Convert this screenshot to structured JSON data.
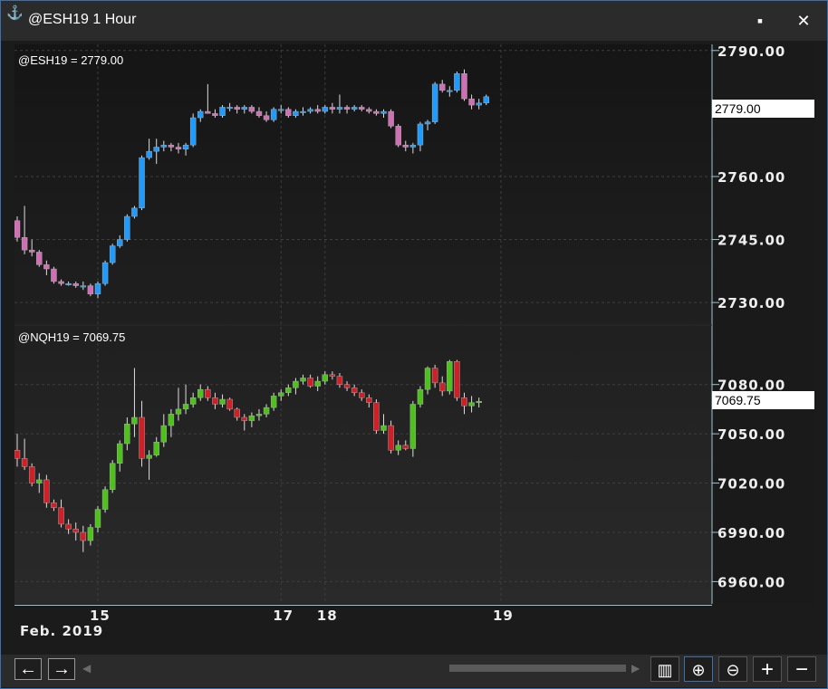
{
  "window": {
    "title": "@ESH19 1 Hour",
    "app_icon": "bull-bear-icon",
    "maximize_icon": "maximize-icon",
    "close_icon": "close-icon",
    "maximize_glyph": "▪",
    "close_glyph": "✕"
  },
  "colors": {
    "es_bull": "#1e9bff",
    "es_bear": "#d070b4",
    "nq_bull": "#4cc21a",
    "nq_bear": "#cf2028",
    "wick": "#dddddd",
    "grid": "#3e3e3e",
    "axis": "#9fc6d6"
  },
  "xaxis": {
    "ticks": [
      {
        "label": "15",
        "index": 11
      },
      {
        "label": "17",
        "index": 36
      },
      {
        "label": "18",
        "index": 42
      },
      {
        "label": "19",
        "index": 66
      }
    ],
    "sublabel": "Feb. 2019"
  },
  "toolbar": {
    "back_glyph": "←",
    "forward_glyph": "→",
    "scroll_left_glyph": "◀",
    "scroll_right_glyph": "▶",
    "columns_glyph": "▥",
    "zoom_in_glyph": "⊕",
    "zoom_out_glyph": "⊖",
    "plus_glyph": "+",
    "minus_glyph": "−"
  },
  "chart_data": [
    {
      "type": "candlestick",
      "label": "@ESH19 = 2779.00",
      "last_value": "2779.00",
      "yticks": [
        "2790.00",
        "2760.00",
        "2745.00",
        "2730.00"
      ],
      "ytick_values": [
        2790,
        2760,
        2745,
        2730
      ],
      "ylim": [
        2725.5,
        2790.6
      ],
      "ohlc": [
        [
          2749.5,
          2750.5,
          2744.5,
          2745.5
        ],
        [
          2745.5,
          2753,
          2741.5,
          2742.5
        ],
        [
          2742.5,
          2745,
          2741,
          2742
        ],
        [
          2742,
          2742.5,
          2738.5,
          2739
        ],
        [
          2739,
          2740,
          2736.5,
          2738
        ],
        [
          2738,
          2738.5,
          2734.5,
          2735
        ],
        [
          2735,
          2735.5,
          2734,
          2734.5
        ],
        [
          2734.5,
          2735,
          2734,
          2734.5
        ],
        [
          2734.5,
          2735,
          2733.5,
          2734
        ],
        [
          2734,
          2735,
          2733,
          2734
        ],
        [
          2734,
          2734.5,
          2731.5,
          2732
        ],
        [
          2732,
          2735,
          2731,
          2734.5
        ],
        [
          2734.5,
          2740,
          2734,
          2739.5
        ],
        [
          2739.5,
          2744,
          2739,
          2743.5
        ],
        [
          2743.5,
          2746,
          2743,
          2745
        ],
        [
          2745,
          2751,
          2744.5,
          2750.5
        ],
        [
          2750.5,
          2753,
          2750,
          2752.5
        ],
        [
          2752.5,
          2765,
          2752,
          2764.5
        ],
        [
          2764.5,
          2769,
          2764,
          2766
        ],
        [
          2766,
          2769,
          2763,
          2767
        ],
        [
          2767,
          2768.5,
          2766,
          2767.5
        ],
        [
          2767.5,
          2768,
          2766,
          2767
        ],
        [
          2767,
          2768,
          2765.5,
          2766.5
        ],
        [
          2766.5,
          2768,
          2765,
          2767.5
        ],
        [
          2767.5,
          2775,
          2767,
          2774
        ],
        [
          2774,
          2776,
          2773,
          2775.5
        ],
        [
          2775.5,
          2782,
          2775,
          2775
        ],
        [
          2775,
          2776,
          2774,
          2774.5
        ],
        [
          2774.5,
          2777,
          2774,
          2776.5
        ],
        [
          2776.5,
          2777.5,
          2775.5,
          2776.5
        ],
        [
          2776.5,
          2777,
          2775,
          2776
        ],
        [
          2776,
          2777,
          2775,
          2776.5
        ],
        [
          2776.5,
          2777,
          2775,
          2775.5
        ],
        [
          2775.5,
          2776.5,
          2774,
          2774.5
        ],
        [
          2774.5,
          2775.5,
          2773,
          2773.5
        ],
        [
          2773.5,
          2776.5,
          2773,
          2776
        ],
        [
          2776,
          2777,
          2775,
          2776
        ],
        [
          2776,
          2776.5,
          2774,
          2774.5
        ],
        [
          2774.5,
          2776,
          2774,
          2775.5
        ],
        [
          2775.5,
          2776.5,
          2774.5,
          2775.5
        ],
        [
          2775.5,
          2776.5,
          2775,
          2776
        ],
        [
          2776,
          2777,
          2775,
          2775.5
        ],
        [
          2775.5,
          2777,
          2775,
          2776.5
        ],
        [
          2776.5,
          2777.5,
          2775,
          2776
        ],
        [
          2776,
          2779.5,
          2775,
          2776.5
        ],
        [
          2776.5,
          2777,
          2775,
          2776
        ],
        [
          2776,
          2777,
          2775.5,
          2776.5
        ],
        [
          2776.5,
          2777,
          2775.5,
          2776
        ],
        [
          2776,
          2776.5,
          2775,
          2775.5
        ],
        [
          2775.5,
          2776,
          2774.5,
          2775
        ],
        [
          2775,
          2776,
          2774,
          2775.5
        ],
        [
          2775.5,
          2776,
          2771.5,
          2772
        ],
        [
          2772,
          2772.5,
          2767,
          2767.5
        ],
        [
          2767.5,
          2768.5,
          2766,
          2767
        ],
        [
          2767,
          2768,
          2765.5,
          2767.5
        ],
        [
          2767.5,
          2773,
          2766,
          2772.5
        ],
        [
          2772.5,
          2773.5,
          2771,
          2773
        ],
        [
          2773,
          2782.5,
          2772.5,
          2782
        ],
        [
          2782,
          2783,
          2780,
          2780.5
        ],
        [
          2780.5,
          2781.5,
          2779,
          2780.5
        ],
        [
          2780.5,
          2785,
          2780,
          2784.5
        ],
        [
          2784.5,
          2785.5,
          2778,
          2778.5
        ],
        [
          2778.5,
          2779.5,
          2776,
          2777
        ],
        [
          2777,
          2778.5,
          2776,
          2777.5
        ],
        [
          2777.5,
          2779.5,
          2777,
          2779
        ]
      ]
    },
    {
      "type": "candlestick",
      "label": "@NQH19 = 7069.75",
      "last_value": "7069.75",
      "yticks": [
        "7080.00",
        "7050.00",
        "7020.00",
        "6990.00",
        "6960.00"
      ],
      "ytick_values": [
        7080,
        7050,
        7020,
        6990,
        6960
      ],
      "ylim": [
        6947,
        7114
      ],
      "ohlc": [
        [
          7040,
          7050,
          7030,
          7035
        ],
        [
          7035,
          7047,
          7028,
          7030
        ],
        [
          7030,
          7032,
          7018,
          7020
        ],
        [
          7020,
          7026,
          7014,
          7022
        ],
        [
          7022,
          7025,
          7005,
          7008
        ],
        [
          7008,
          7010,
          7003,
          7005
        ],
        [
          7005,
          7010,
          6993,
          6995
        ],
        [
          6995,
          6998,
          6989,
          6992
        ],
        [
          6992,
          6996,
          6985,
          6990
        ],
        [
          6990,
          6994,
          6978,
          6985
        ],
        [
          6985,
          6995,
          6982,
          6993
        ],
        [
          6993,
          7006,
          6990,
          7004
        ],
        [
          7004,
          7018,
          7002,
          7016
        ],
        [
          7016,
          7034,
          7014,
          7032
        ],
        [
          7032,
          7046,
          7027,
          7044
        ],
        [
          7044,
          7060,
          7040,
          7056
        ],
        [
          7056,
          7090,
          7048,
          7060
        ],
        [
          7060,
          7070,
          7030,
          7035
        ],
        [
          7035,
          7040,
          7022,
          7037
        ],
        [
          7037,
          7048,
          7036,
          7045
        ],
        [
          7045,
          7062,
          7042,
          7055
        ],
        [
          7055,
          7065,
          7048,
          7062
        ],
        [
          7062,
          7078,
          7058,
          7065
        ],
        [
          7065,
          7080,
          7062,
          7068
        ],
        [
          7068,
          7075,
          7066,
          7072
        ],
        [
          7072,
          7080,
          7070,
          7077
        ],
        [
          7077,
          7079,
          7070,
          7072
        ],
        [
          7072,
          7075,
          7065,
          7068
        ],
        [
          7068,
          7074,
          7066,
          7071
        ],
        [
          7071,
          7072,
          7064,
          7065
        ],
        [
          7065,
          7066,
          7058,
          7060
        ],
        [
          7060,
          7062,
          7052,
          7058
        ],
        [
          7058,
          7063,
          7054,
          7061
        ],
        [
          7061,
          7065,
          7058,
          7062
        ],
        [
          7062,
          7068,
          7060,
          7066
        ],
        [
          7066,
          7075,
          7064,
          7073
        ],
        [
          7073,
          7077,
          7070,
          7075
        ],
        [
          7075,
          7080,
          7073,
          7078
        ],
        [
          7078,
          7084,
          7074,
          7082
        ],
        [
          7082,
          7086,
          7080,
          7084
        ],
        [
          7084,
          7086,
          7078,
          7079
        ],
        [
          7079,
          7085,
          7076,
          7082
        ],
        [
          7082,
          7088,
          7080,
          7086
        ],
        [
          7086,
          7088,
          7083,
          7085
        ],
        [
          7085,
          7087,
          7078,
          7080
        ],
        [
          7080,
          7082,
          7076,
          7078
        ],
        [
          7078,
          7080,
          7073,
          7075
        ],
        [
          7075,
          7077,
          7070,
          7072
        ],
        [
          7072,
          7074,
          7066,
          7069
        ],
        [
          7069,
          7071,
          7050,
          7052
        ],
        [
          7052,
          7062,
          7050,
          7055
        ],
        [
          7055,
          7058,
          7038,
          7040
        ],
        [
          7040,
          7046,
          7037,
          7043
        ],
        [
          7043,
          7046,
          7040,
          7041
        ],
        [
          7041,
          7070,
          7036,
          7068
        ],
        [
          7068,
          7079,
          7066,
          7077
        ],
        [
          7077,
          7091,
          7074,
          7090
        ],
        [
          7090,
          7092,
          7078,
          7081
        ],
        [
          7081,
          7085,
          7073,
          7076
        ],
        [
          7076,
          7095,
          7074,
          7094
        ],
        [
          7094,
          7095,
          7070,
          7072
        ],
        [
          7072,
          7075,
          7062,
          7067
        ],
        [
          7067,
          7073,
          7063,
          7069
        ],
        [
          7069,
          7072,
          7066,
          7069.75
        ]
      ]
    }
  ]
}
